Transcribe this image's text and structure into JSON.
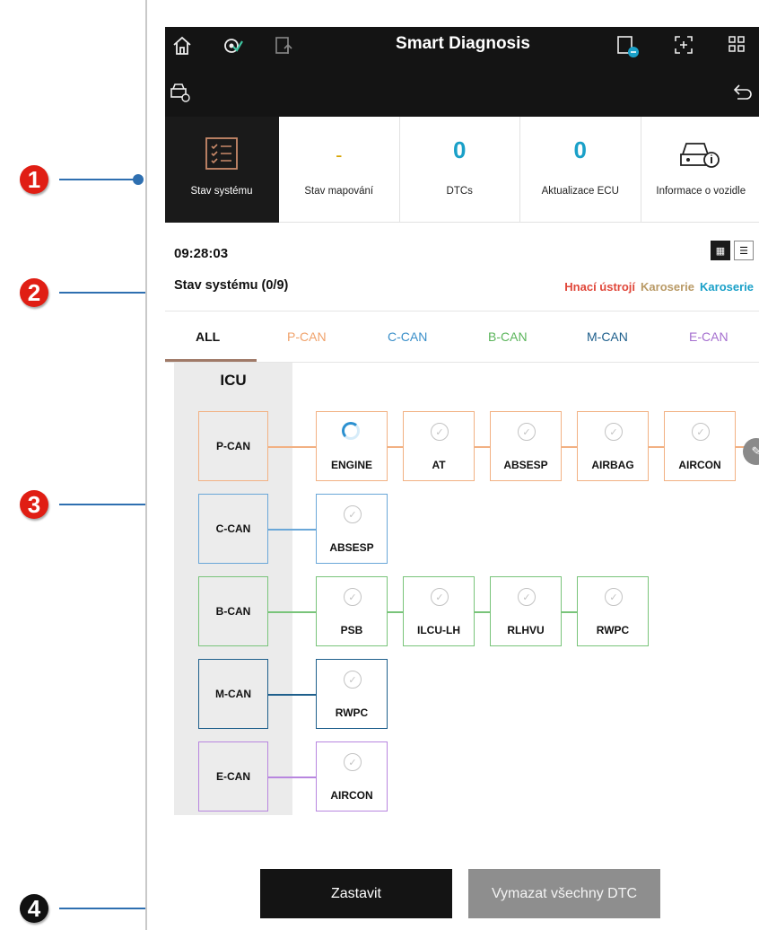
{
  "callouts": [
    {
      "num": "1",
      "color": "#e01e14"
    },
    {
      "num": "2",
      "color": "#e01e14"
    },
    {
      "num": "3",
      "color": "#e01e14"
    },
    {
      "num": "4",
      "color": "#111111"
    }
  ],
  "header": {
    "title": "Smart Diagnosis",
    "icons_left": [
      "home-icon",
      "settings-check-icon",
      "upload-document-icon"
    ],
    "icons_right": [
      "vci-connection-icon",
      "screen-capture-icon",
      "apps-grid-icon"
    ],
    "row2_left_icon": "car-check-icon",
    "row2_right_icon": "back-arrow-icon"
  },
  "tiles": [
    {
      "label": "Stav systému",
      "icon": "checklist-icon"
    },
    {
      "label": "Stav mapování",
      "value": "-"
    },
    {
      "label": "DTCs",
      "value": "0"
    },
    {
      "label": "Aktualizace ECU",
      "value": "0"
    },
    {
      "label": "Informace o vozidle",
      "icon": "vehicle-info-icon"
    }
  ],
  "time": "09:28:03",
  "status_title": "Stav systému (0/9)",
  "legend": [
    {
      "label": "Hnací ústrojí",
      "color": "#e0473a"
    },
    {
      "label": "Karoserie",
      "color": "#b99a66"
    },
    {
      "label": "Karoserie",
      "color": "#1aa0c8"
    }
  ],
  "tabs": [
    {
      "label": "ALL",
      "color": "#111111"
    },
    {
      "label": "P-CAN",
      "color": "#f0a26b"
    },
    {
      "label": "C-CAN",
      "color": "#3a8fc9"
    },
    {
      "label": "B-CAN",
      "color": "#5bb55b"
    },
    {
      "label": "M-CAN",
      "color": "#1e5f8c"
    },
    {
      "label": "E-CAN",
      "color": "#a56fcf"
    }
  ],
  "icu_label": "ICU",
  "buses": [
    {
      "name": "P-CAN",
      "color": "#f2b183",
      "ecus": [
        {
          "name": "ENGINE",
          "state": "loading"
        },
        {
          "name": "AT",
          "state": "done"
        },
        {
          "name": "ABSESP",
          "state": "done"
        },
        {
          "name": "AIRBAG",
          "state": "done"
        },
        {
          "name": "AIRCON",
          "state": "done"
        }
      ]
    },
    {
      "name": "C-CAN",
      "color": "#6aa7d8",
      "ecus": [
        {
          "name": "ABSESP",
          "state": "done"
        }
      ]
    },
    {
      "name": "B-CAN",
      "color": "#79c47a",
      "ecus": [
        {
          "name": "PSB",
          "state": "done"
        },
        {
          "name": "ILCU-LH",
          "state": "done"
        },
        {
          "name": "RLHVU",
          "state": "done"
        },
        {
          "name": "RWPC",
          "state": "done"
        }
      ]
    },
    {
      "name": "M-CAN",
      "color": "#1e5f8c",
      "ecus": [
        {
          "name": "RWPC",
          "state": "done"
        }
      ]
    },
    {
      "name": "E-CAN",
      "color": "#b886df",
      "ecus": [
        {
          "name": "AIRCON",
          "state": "done"
        }
      ]
    }
  ],
  "buttons": {
    "stop": "Zastavit",
    "clear": "Vymazat všechny DTC"
  }
}
